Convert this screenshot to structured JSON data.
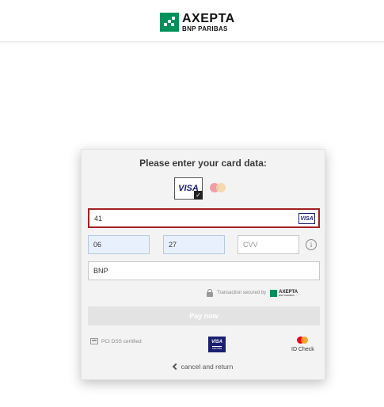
{
  "header": {
    "brand_name": "AXEPTA",
    "brand_sub": "BNP PARIBAS"
  },
  "panel": {
    "title": "Please enter your card data:",
    "card_brands": [
      {
        "name": "VISA",
        "selected": true
      },
      {
        "name": "Mastercard",
        "selected": false
      }
    ],
    "card_number": {
      "value": "41",
      "detected_brand": "VISA"
    },
    "expiry_month": {
      "value": "06"
    },
    "expiry_year": {
      "value": "27"
    },
    "cvv": {
      "placeholder": "CVV",
      "value": ""
    },
    "cardholder": {
      "value": "BNP"
    },
    "secured_text": "Transaction secured by",
    "secured_brand": "AXEPTA",
    "secured_brand_sub": "BNP PARIBAS",
    "pay_button_label": "Pay now",
    "pci_text": "PCI DSS certified",
    "visa_secure_top": "VISA",
    "visa_secure_bottom": "SECURE",
    "id_check_label": "ID Check",
    "cancel_label": "cancel and return"
  },
  "colors": {
    "axepta_green": "#00915a",
    "error_border": "#a32020",
    "autofill_bg": "#e8f0fe",
    "visa_blue": "#1a1f71",
    "mc_red": "#eb001b",
    "mc_orange": "#f79e1b"
  }
}
